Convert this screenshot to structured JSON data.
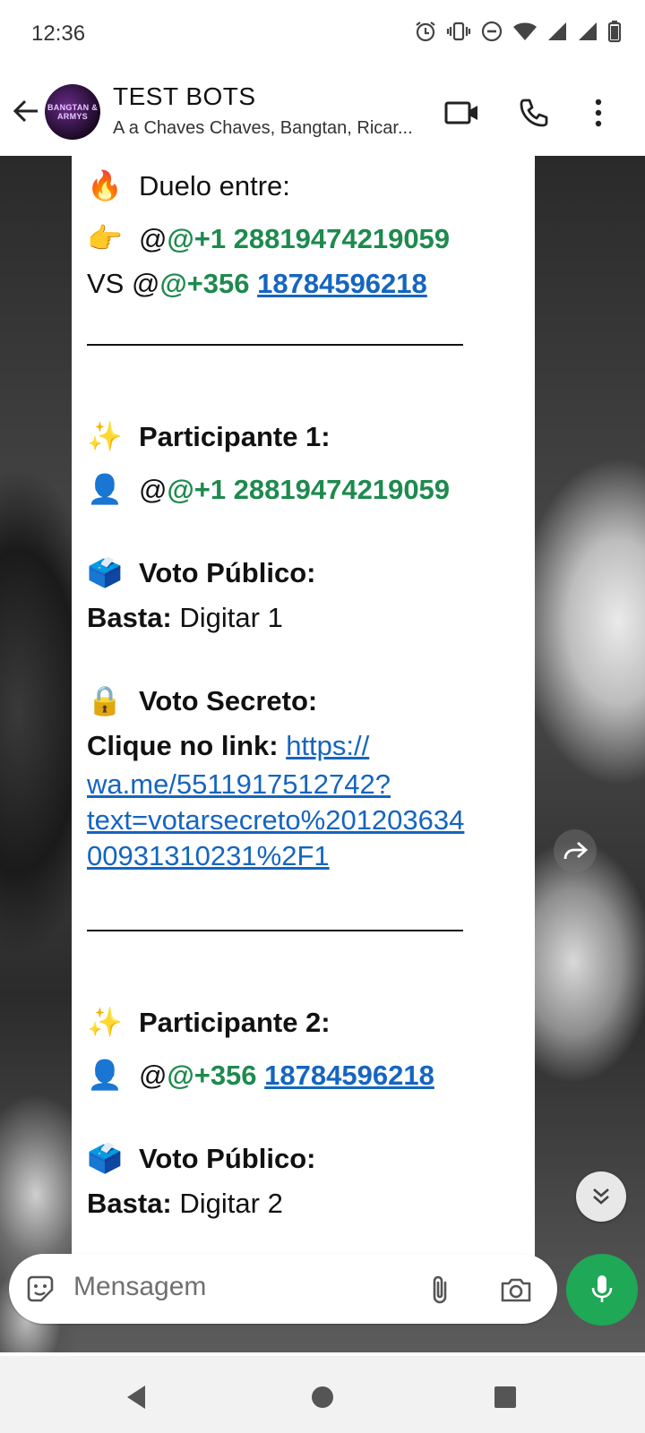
{
  "status_bar": {
    "time": "12:36",
    "icons": [
      "alarm-icon",
      "vibrate-icon",
      "dnd-icon",
      "wifi-icon",
      "signal-icon",
      "signal-icon",
      "battery-icon"
    ]
  },
  "header": {
    "title": "TEST BOTS",
    "subtitle": "A a Chaves Chaves, Bangtan, Ricar...",
    "avatar_text": "BANGTAN & ARMYS",
    "actions": [
      "video-call-icon",
      "voice-call-icon",
      "more-options-icon"
    ]
  },
  "message": {
    "duel_label": "Duelo entre:",
    "duel_p1_at": "@",
    "duel_p1": "@+1 28819474219059",
    "duel_vs": "VS @",
    "duel_p2_code": "@+356",
    "duel_p2_number": "18784596218",
    "participant1_label": "Participante 1:",
    "participant1_at": "@",
    "participant1": "@+1 28819474219059",
    "public_vote_label": "Voto Público:",
    "basta_label": "Basta:",
    "vote1_text": "Digitar 1",
    "secret_vote_label": "Voto Secreto:",
    "click_link_label": "Clique no link:",
    "secret_link": "https://wa.me/5511917512742?text=votarsecreto%20120363400931310231%2F1",
    "secret_link_lines": [
      "https://",
      "wa.me/5511917512742?",
      "text=votarsecreto%201203634",
      "00931310231%2F1"
    ],
    "participant2_label": "Participante 2:",
    "participant2_at": "@",
    "participant2_code": "@+356",
    "participant2_number": "18784596218",
    "public_vote_label_2": "Voto Público:",
    "basta_label_2": "Basta:",
    "vote2_text": "Digitar 2"
  },
  "composer": {
    "placeholder": "Mensagem"
  },
  "colors": {
    "mention_green": "#1e8a4e",
    "link_blue": "#1565c0",
    "mic_button": "#1fa855"
  }
}
